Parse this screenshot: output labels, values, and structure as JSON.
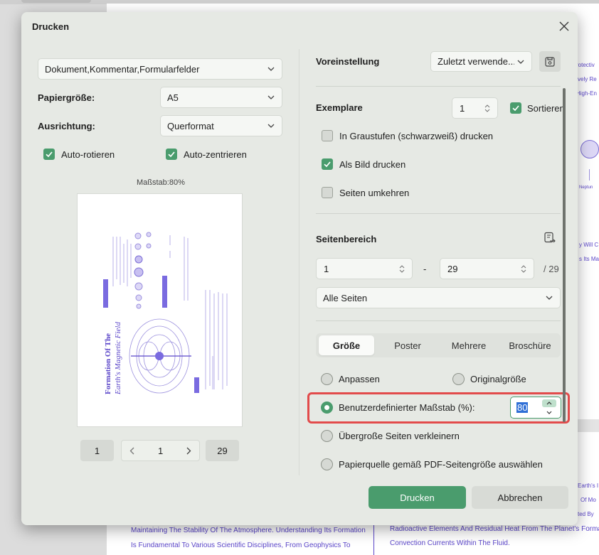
{
  "background": {
    "lines_right": [
      "rotectiv",
      "vely Re",
      "High-En",
      "Neptun",
      "y Will C",
      "s Its Ma",
      "Earth's I",
      "Of Mo",
      "ted By"
    ],
    "lines_bottom_left": [
      "Maintaining The Stability Of The Atmosphere. Understanding Its Formation",
      "Is Fundamental To Various Scientific Disciplines, From Geophysics To"
    ],
    "lines_bottom_right": [
      "Radioactive Elements And Residual Heat From The Planet's Formation",
      "Convection Currents Within The Fluid."
    ]
  },
  "dialog": {
    "title": "Drucken",
    "close_icon": "close-icon"
  },
  "left": {
    "content_select": "Dokument,Kommentar,Formularfelder",
    "paper_size_label": "Papiergröße:",
    "paper_size_value": "A5",
    "orientation_label": "Ausrichtung:",
    "orientation_value": "Querformat",
    "auto_rotate_label": "Auto-rotieren",
    "auto_rotate_checked": true,
    "auto_center_label": "Auto-zentrieren",
    "auto_center_checked": true,
    "scale_caption": "Maßstab:80%",
    "preview": {
      "title_line1": "Formation Of The",
      "title_line2": "Earth's Magnetic Field"
    },
    "pager": {
      "first": "1",
      "current": "1",
      "last": "29"
    }
  },
  "right": {
    "preset_label": "Voreinstellung",
    "preset_value": "Zuletzt verwende...",
    "copies_label": "Exemplare",
    "copies_value": "1",
    "sort_label": "Sortieren",
    "sort_checked": true,
    "grayscale_label": "In Graustufen (schwarzweiß) drucken",
    "grayscale_checked": false,
    "as_image_label": "Als Bild drucken",
    "as_image_checked": true,
    "reverse_label": "Seiten umkehren",
    "reverse_checked": false,
    "page_range_label": "Seitenbereich",
    "range_from": "1",
    "range_separator": "-",
    "range_to": "29",
    "range_total": "/ 29",
    "pages_select": "Alle Seiten",
    "tabs": [
      "Größe",
      "Poster",
      "Mehrere",
      "Broschüre"
    ],
    "active_tab": 0,
    "fit_label": "Anpassen",
    "original_size_label": "Originalgröße",
    "custom_scale_label": "Benutzerdefinierter Maßstab (%):",
    "custom_scale_value": "80",
    "shrink_label": "Übergroße Seiten verkleinern",
    "paper_source_label": "Papierquelle gemäß PDF-Seitengröße auswählen"
  },
  "buttons": {
    "print": "Drucken",
    "cancel": "Abbrechen"
  },
  "colors": {
    "accent": "#4a9c6d",
    "highlight": "#e24b4b",
    "dialog_bg": "#e6e9e4"
  }
}
